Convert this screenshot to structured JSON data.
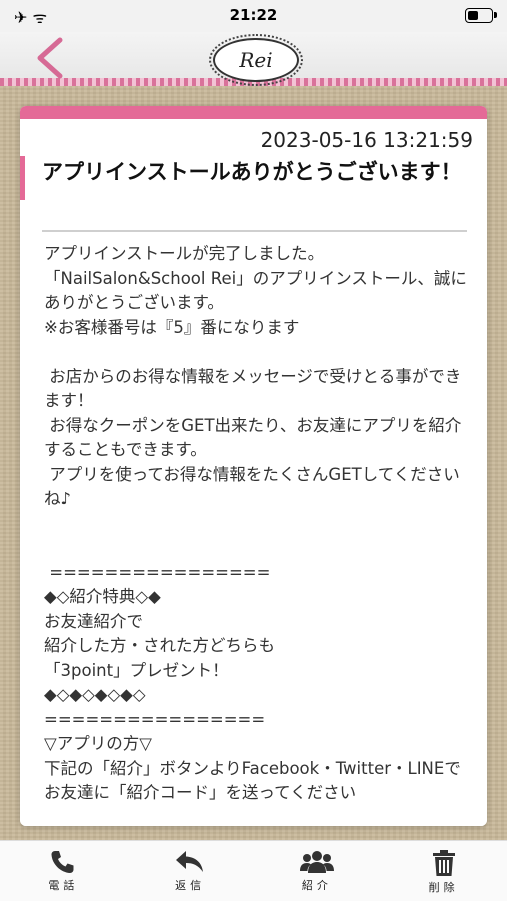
{
  "status": {
    "time": "21:22",
    "left_icons": "✈ ᯤ",
    "battery_level": 0.45
  },
  "header": {
    "logo_text": "Rei"
  },
  "message": {
    "date": "2023-05-16 13:21:59",
    "title": "アプリインストールありがとうございます！",
    "body": "アプリインストールが完了しました。\n「NailSalon&School Rei」のアプリインストール、誠にありがとうございます。\n※お客様番号は『5』番になります\n\n お店からのお得な情報をメッセージで受けとる事ができます！\n お得なクーポンをGET出来たり、お友達にアプリを紹介することもできます。\n アプリを使ってお得な情報をたくさんGETしてくださいね♪\n\n\n ================\n◆◇紹介特典◇◆\nお友達紹介で\n紹介した方・された方どちらも\n「3point」プレゼント！\n◆◇◆◇◆◇◆◇\n================\n▽アプリの方▽\n下記の「紹介」ボタンよりFacebook・Twitter・LINEでお友達に「紹介コード」を送ってください"
  },
  "tabs": [
    {
      "label": "電話",
      "icon": "phone-icon"
    },
    {
      "label": "返信",
      "icon": "reply-icon"
    },
    {
      "label": "紹介",
      "icon": "people-icon"
    },
    {
      "label": "削除",
      "icon": "trash-icon"
    }
  ],
  "colors": {
    "accent": "#e46a97",
    "background": "#c8b899"
  }
}
